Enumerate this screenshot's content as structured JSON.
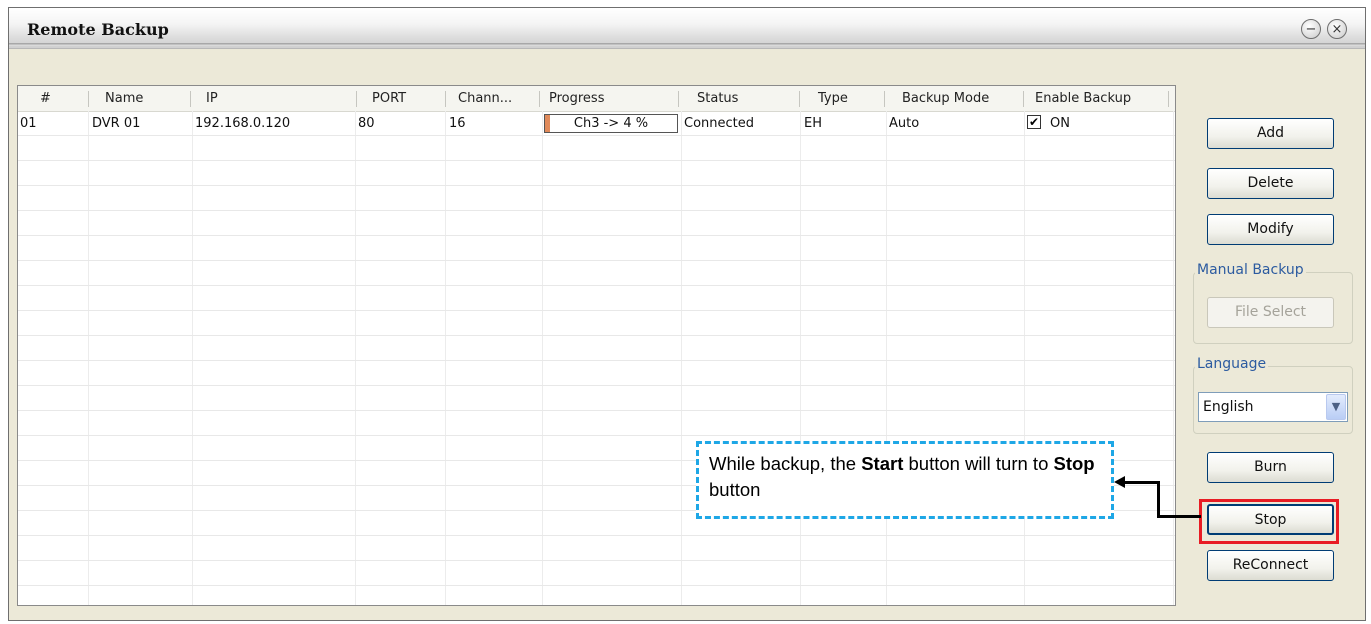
{
  "window": {
    "title": "Remote Backup",
    "minimize_glyph": "−",
    "close_glyph": "×"
  },
  "table": {
    "columns": [
      "#",
      "Name",
      "IP",
      "PORT",
      "Chann...",
      "Progress",
      "Status",
      "Type",
      "Backup Mode",
      "Enable Backup"
    ],
    "rows": [
      {
        "num": "01",
        "name": "DVR 01",
        "ip": "192.168.0.120",
        "port": "80",
        "channels": "16",
        "progress_text": "Ch3 -> 4 %",
        "progress_value": 4,
        "status": "Connected",
        "type": "EH",
        "backup_mode": "Auto",
        "enable_checked": true,
        "enable_text": "ON"
      }
    ]
  },
  "buttons": {
    "add": "Add",
    "delete": "Delete",
    "modify": "Modify",
    "file_select": "File Select",
    "burn": "Burn",
    "stop": "Stop",
    "reconnect": "ReConnect"
  },
  "groups": {
    "manual_backup": "Manual Backup",
    "language": "Language"
  },
  "language_select": {
    "value": "English"
  },
  "callout": {
    "pre": "While backup, the ",
    "bold1": "Start",
    "mid": " button will turn to ",
    "bold2": "Stop",
    "post": " button"
  },
  "colors": {
    "highlight_box": "#e81c24",
    "callout_border": "#1ea7e6",
    "progress_fill": "#e08a5a"
  }
}
